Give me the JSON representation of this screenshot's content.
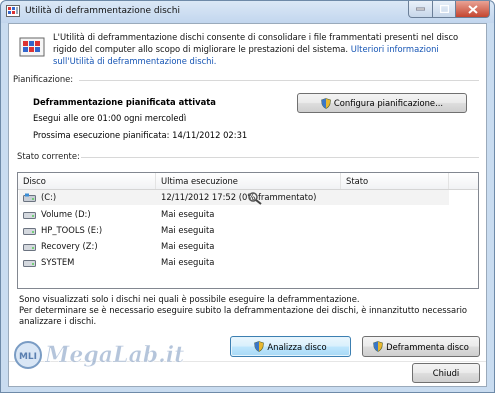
{
  "window": {
    "title": "Utilità di deframmentazione dischi"
  },
  "intro": {
    "text": "L'Utilità di deframmentazione dischi consente di consolidare i file frammentati presenti nel disco rigido del computer allo scopo di migliorare le prestazioni del sistema.",
    "link": "Ulteriori informazioni sull'Utilità di deframmentazione dischi."
  },
  "schedule": {
    "label": "Pianificazione:",
    "status": "Deframmentazione pianificata attivata",
    "when": "Esegui alle ore 01:00 ogni mercoledì",
    "next": "Prossima esecuzione pianificata: 14/11/2012 02:31",
    "configure_label": "Configura pianificazione..."
  },
  "current": {
    "label": "Stato corrente:",
    "columns": [
      "Disco",
      "Ultima esecuzione",
      "Stato"
    ],
    "rows": [
      {
        "disk": "(C:)",
        "last": "12/11/2012 17:52 (0% frammentato)",
        "status": ""
      },
      {
        "disk": "Volume (D:)",
        "last": "Mai eseguita",
        "status": ""
      },
      {
        "disk": "HP_TOOLS (E:)",
        "last": "Mai eseguita",
        "status": ""
      },
      {
        "disk": "Recovery (Z:)",
        "last": "Mai eseguita",
        "status": ""
      },
      {
        "disk": "SYSTEM",
        "last": "Mai eseguita",
        "status": ""
      }
    ]
  },
  "footer": {
    "line1": "Sono visualizzati solo i dischi nei quali è possibile eseguire la deframmentazione.",
    "line2": "Per determinare se è necessario eseguire subito la deframmentazione dei dischi, è innanzitutto necessario",
    "line3": "analizzare i dischi."
  },
  "buttons": {
    "analyze": "Analizza disco",
    "defrag": "Deframmenta disco",
    "close": "Chiudi"
  },
  "watermark": {
    "text": "MegaLab.it"
  },
  "icons": {
    "title": "defrag-app-icon",
    "shield": "uac-shield-icon",
    "drive": "hard-drive-icon"
  },
  "colors": {
    "link": "#1655b4",
    "titlebar": "#c2d6ee",
    "close": "#c4452f"
  }
}
